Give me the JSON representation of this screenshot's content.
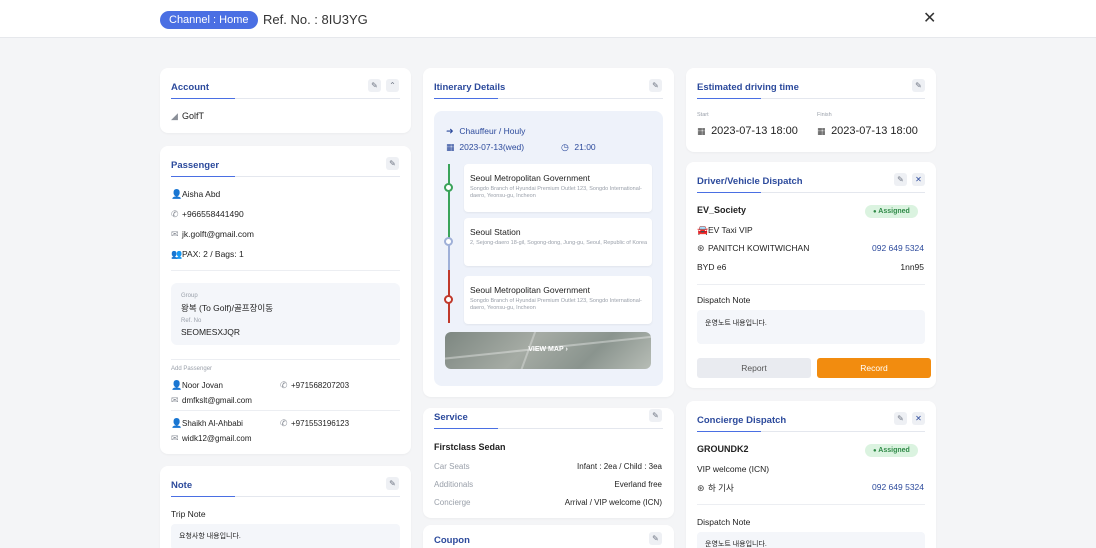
{
  "header": {
    "channel": "Channel : Home",
    "ref_no": "Ref. No. : 8IU3YG",
    "close_icon": "✕"
  },
  "account": {
    "title": "Account",
    "name": "GolfT"
  },
  "passenger": {
    "title": "Passenger",
    "name": "Aisha Abd",
    "phone": "+966558441490",
    "email": "jk.golft@gmail.com",
    "pax": "PAX: 2 / Bags: 1",
    "group_label": "Group",
    "group_value": "왕복 (To Golf)/골프장이동",
    "ref_label": "Ref. No",
    "ref_value": "SEOMESXJQR",
    "add_label": "Add Passenger",
    "additional": [
      {
        "name": "Noor Jovan",
        "phone": "+971568207203",
        "email": "dmfkslt@gmail.com"
      },
      {
        "name": "Shaikh Al-Ahbabi",
        "phone": "+971553196123",
        "email": "widk12@gmail.com"
      }
    ]
  },
  "note": {
    "title": "Note",
    "trip_note_label": "Trip Note",
    "trip_note_text": "요청사항 내용입니다."
  },
  "itinerary": {
    "title": "Itinerary Details",
    "service_type": "Chauffeur / Houly",
    "date": "2023-07-13(wed)",
    "time": "21:00",
    "stops": [
      {
        "name": "Seoul Metropolitan Government",
        "address": "Songdo Branch of Hyundai Premium Outlet 123, Songdo International-daero, Yeonsu-gu, Incheon"
      },
      {
        "name": "Seoul Station",
        "address": "2, Sejong-daero 18-gil, Sogong-dong, Jung-gu, Seoul, Republic of Korea"
      },
      {
        "name": "Seoul Metropolitan Government",
        "address": "Songdo Branch of Hyundai Premium Outlet 123, Songdo International-daero, Yeonsu-gu, Incheon"
      }
    ],
    "view_map": "VIEW MAP"
  },
  "service": {
    "title": "Service",
    "vehicle": "Firstclass Sedan",
    "rows": [
      {
        "label": "Car Seats",
        "value": "Infant : 2ea / Child : 3ea"
      },
      {
        "label": "Additionals",
        "value": "Everland free"
      },
      {
        "label": "Concierge",
        "value": "Arrival / VIP welcome (ICN)"
      }
    ]
  },
  "coupon": {
    "title": "Coupon"
  },
  "driving_time": {
    "title": "Estimated driving time",
    "start_label": "Start",
    "start_value": "2023-07-13 18:00",
    "finish_label": "Finish",
    "finish_value": "2023-07-13 18:00"
  },
  "dispatch": {
    "title": "Driver/Vehicle Dispatch",
    "company": "EV_Society",
    "status": "Assigned",
    "vehicle_class": "EV Taxi VIP",
    "driver": "PANITCH KOWITWICHAN",
    "driver_phone": "092 649 5324",
    "model": "BYD e6",
    "plate": "1nn95",
    "note_label": "Dispatch Note",
    "note_text": "운영노트 내용입니다.",
    "report_label": "Report",
    "record_label": "Record"
  },
  "concierge": {
    "title": "Concierge Dispatch",
    "company": "GROUNDK2",
    "status": "Assigned",
    "service": "VIP welcome (ICN)",
    "person": "하 기사",
    "phone": "092 649 5324",
    "note_label": "Dispatch Note",
    "note_text": "운영노트 내용입니다."
  },
  "colors": {
    "accent": "#4a6fe3",
    "title_blue": "#2c4a9c",
    "record_orange": "#f28c0f",
    "assigned_green": "#2f8a47",
    "route_green": "#3aa35a",
    "route_red": "#c0392b"
  },
  "icons": [
    "close-icon",
    "edit-icon",
    "collapse-icon",
    "signal-icon",
    "person-icon",
    "phone-icon",
    "mail-icon",
    "group-icon",
    "arrow-right-circle-icon",
    "calendar-icon",
    "clock-icon",
    "car-icon",
    "steering-wheel-icon",
    "chevron-right-icon"
  ]
}
